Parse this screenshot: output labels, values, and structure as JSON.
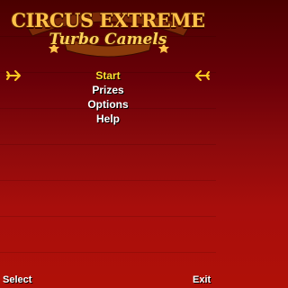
{
  "logo": {
    "title": "CIRCUS EXTREME",
    "subtitle": "Turbo Camels"
  },
  "menu": {
    "items": [
      {
        "label": "Start"
      },
      {
        "label": "Prizes"
      },
      {
        "label": "Options"
      },
      {
        "label": "Help"
      }
    ],
    "selected_index": 0
  },
  "softkeys": {
    "left_label": "Select",
    "right_label": "Exit"
  },
  "colors": {
    "selected_item": "#ffe033",
    "menu_text": "#ffffff",
    "logo_gold": "#ffc24a",
    "arrow": "#ffcc22"
  },
  "icons": {
    "left_arrow": "trident-arrow-right-icon",
    "right_arrow": "trident-arrow-left-icon"
  }
}
